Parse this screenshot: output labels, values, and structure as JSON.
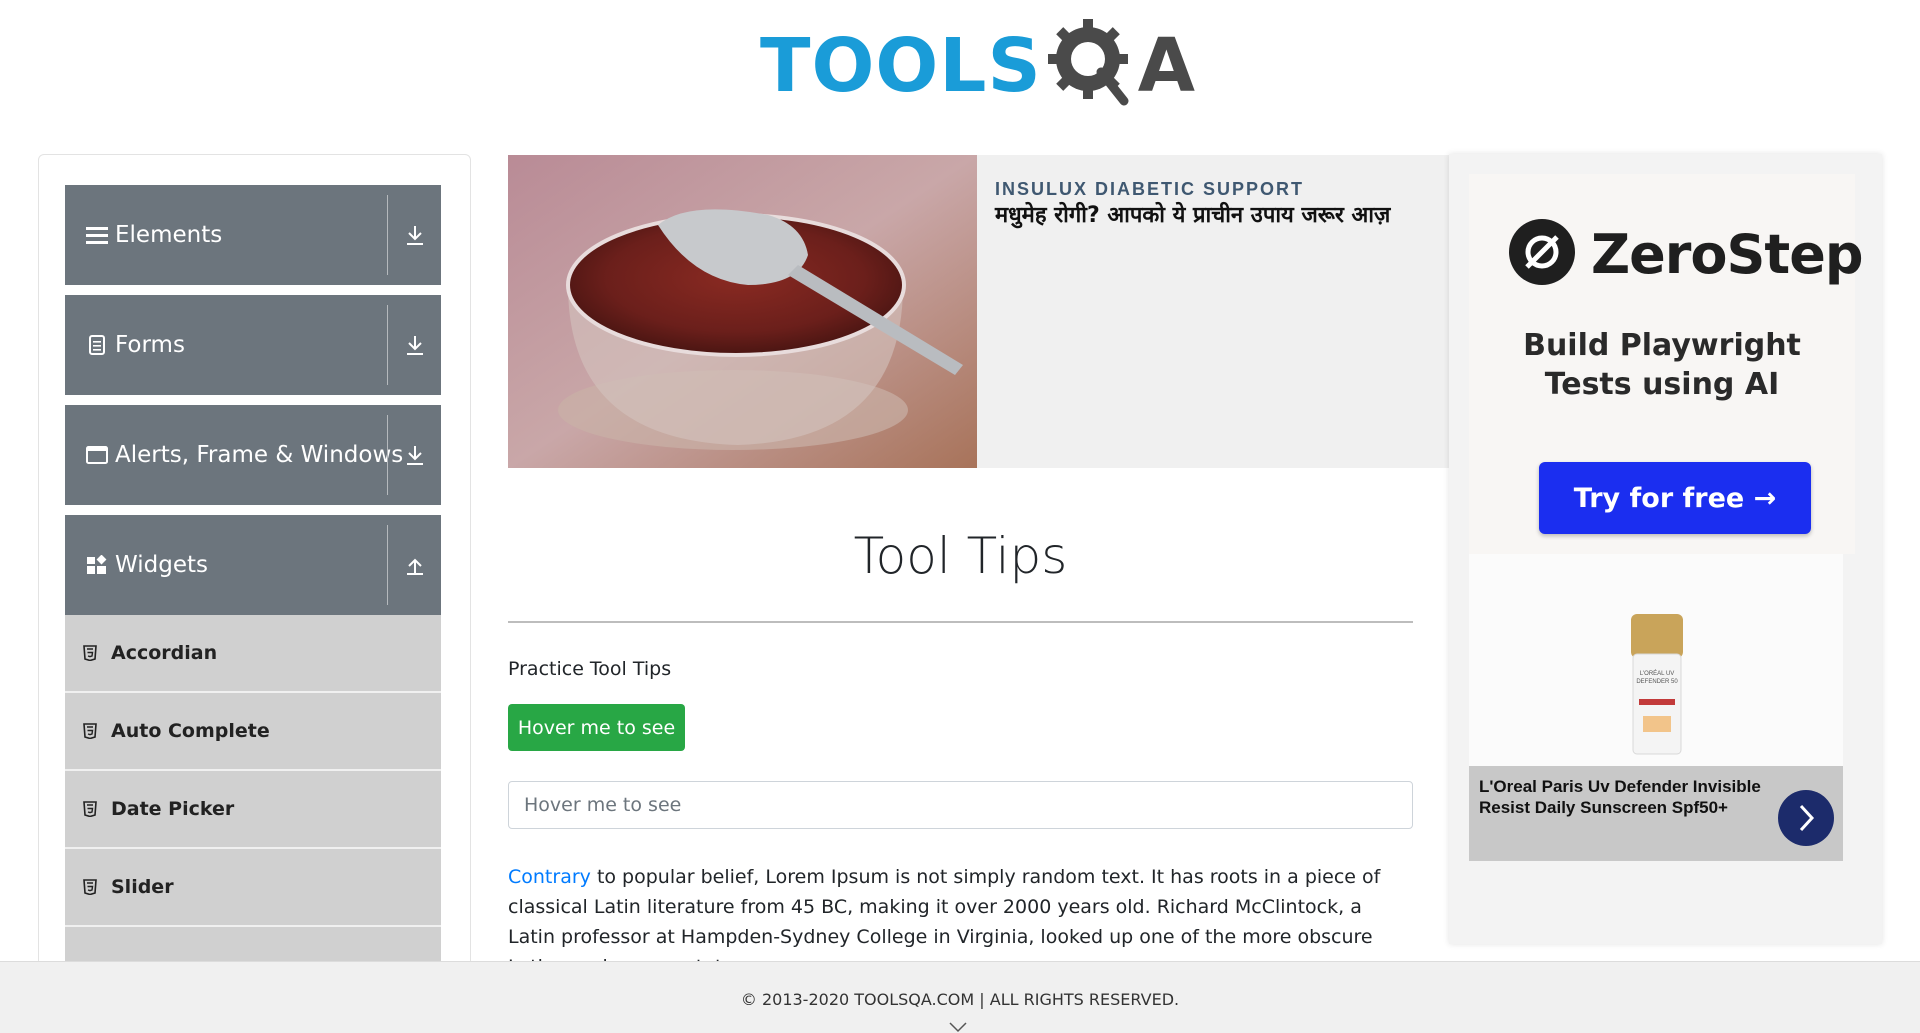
{
  "header": {
    "logo_text": "TOOLS",
    "logo_suffix": "A"
  },
  "sidebar": {
    "groups": [
      {
        "label": "Elements",
        "icon": "hamburger-icon",
        "state": "collapsed"
      },
      {
        "label": "Forms",
        "icon": "document-icon",
        "state": "collapsed"
      },
      {
        "label": "Alerts, Frame & Windows",
        "icon": "window-icon",
        "state": "collapsed"
      },
      {
        "label": "Widgets",
        "icon": "widgets-icon",
        "state": "expanded"
      }
    ],
    "widget_items": [
      {
        "label": "Accordian"
      },
      {
        "label": "Auto Complete"
      },
      {
        "label": "Date Picker"
      },
      {
        "label": "Slider"
      }
    ]
  },
  "ad_top": {
    "brand": "INSULUX DIABETIC SUPPORT",
    "headline": "मधुमेह रोगी? आपको ये प्राचीन उपाय जरूर आज़"
  },
  "main": {
    "title": "Tool Tips",
    "practice_label": "Practice Tool Tips",
    "hover_button_label": "Hover me to see",
    "hover_input_placeholder": "Hover me to see",
    "paragraph_link": "Contrary",
    "paragraph_text": " to popular belief, Lorem Ipsum is not simply random text. It has roots in a piece of classical Latin literature from 45 BC, making it over 2000 years old. Richard McClintock, a Latin professor at Hampden-Sydney College in Virginia, looked up one of the more obscure Latin words, consectetur,"
  },
  "ad_right": {
    "brand": "ZeroStep",
    "subtitle_line1": "Build Playwright",
    "subtitle_line2": "Tests using AI",
    "cta_label": "Try for free →",
    "product_title": "L'Oreal Paris Uv Defender Invisible Resist Daily Sunscreen Spf50+",
    "product_bottle_text": "L'ORÉAL UV DEFENDER 50"
  },
  "footer": {
    "copyright": "© 2013-2020 TOOLSQA.COM | ALL RIGHTS RESERVED."
  },
  "colors": {
    "sidebar_header": "#6c757d",
    "menu_item": "#d0d0d0",
    "primary_green": "#28a745",
    "link_blue": "#007bff",
    "logo_blue": "#1a9cd8",
    "cta_blue": "#1b2ef0"
  }
}
